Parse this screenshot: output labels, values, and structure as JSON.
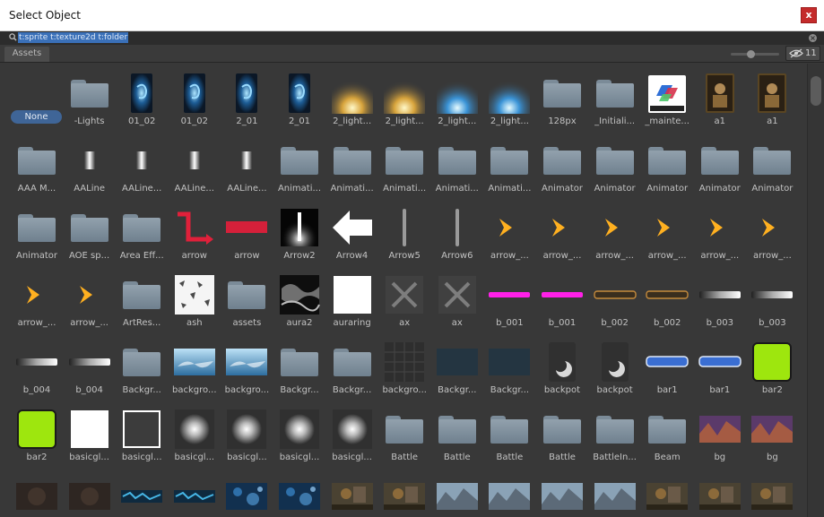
{
  "window": {
    "title": "Select Object",
    "close_label": "x"
  },
  "search": {
    "query": "t:sprite t:texture2d t:folder",
    "clear_label": "×"
  },
  "toolbar": {
    "tab_label": "Assets",
    "visible_count": "11"
  },
  "none_label": "None",
  "assets": [
    [
      "-Lights",
      "01_02",
      "01_02",
      "2_01",
      "2_01",
      "2_light...",
      "2_light...",
      "2_light...",
      "2_light...",
      "128px",
      "_Initiali...",
      "_mainte...",
      "a1",
      "a1"
    ],
    [
      "AAA M...",
      "AALine",
      "AALine...",
      "AALine...",
      "AALine...",
      "Animati...",
      "Animati...",
      "Animati...",
      "Animati...",
      "Animati...",
      "Animator",
      "Animator",
      "Animator",
      "Animator",
      "Animator"
    ],
    [
      "Animator",
      "AOE sp...",
      "Area Eff...",
      "arrow",
      "arrow",
      "Arrow2",
      "Arrow4",
      "Arrow5",
      "Arrow6",
      "arrow_...",
      "arrow_...",
      "arrow_...",
      "arrow_...",
      "arrow_...",
      "arrow_..."
    ],
    [
      "arrow_...",
      "arrow_...",
      "ArtRes...",
      "ash",
      "assets",
      "aura2",
      "auraring",
      "ax",
      "ax",
      "b_001",
      "b_001",
      "b_002",
      "b_002",
      "b_003",
      "b_003"
    ],
    [
      "b_004",
      "b_004",
      "Backgr...",
      "backgro...",
      "backgro...",
      "Backgr...",
      "Backgr...",
      "backgro...",
      "Backgr...",
      "Backgr...",
      "backpot",
      "backpot",
      "bar1",
      "bar1",
      "bar2"
    ],
    [
      "bar2",
      "basicgl...",
      "basicgl...",
      "basicgl...",
      "basicgl...",
      "basicgl...",
      "basicgl...",
      "Battle",
      "Battle",
      "Battle",
      "Battle",
      "BattleIn...",
      "Beam",
      "bg",
      "bg"
    ],
    [
      "",
      "",
      "",
      "",
      "",
      "",
      "",
      "",
      "",
      "",
      "",
      "",
      "",
      "",
      ""
    ]
  ],
  "icons": [
    [
      "folder-icon",
      "blue-swirl-card-icon",
      "blue-swirl-card-icon",
      "blue-swirl-card-icon",
      "blue-swirl-card-icon",
      "gold-light-beam-icon",
      "gold-light-beam-icon",
      "blue-light-beam-icon",
      "blue-light-beam-icon",
      "folder-icon",
      "folder-icon",
      "shadero-logo-icon",
      "character-card-icon",
      "character-card-icon"
    ],
    [
      "folder-icon",
      "aa-line-icon",
      "aa-line-icon",
      "aa-line-icon",
      "aa-line-icon",
      "folder-icon",
      "folder-icon",
      "folder-icon",
      "folder-icon",
      "folder-icon",
      "folder-icon",
      "folder-icon",
      "folder-icon",
      "folder-icon",
      "folder-icon"
    ],
    [
      "folder-icon",
      "folder-icon",
      "folder-icon",
      "red-path-arrow-icon",
      "red-bar-icon",
      "light-pillar-icon",
      "white-arrow-icon",
      "thin-line-icon",
      "thin-line-icon",
      "orange-chevron-icon",
      "orange-chevron-icon",
      "orange-chevron-icon",
      "orange-chevron-icon",
      "orange-chevron-icon",
      "orange-chevron-icon"
    ],
    [
      "orange-chevron-icon",
      "orange-chevron-icon",
      "folder-icon",
      "ash-texture-icon",
      "folder-icon",
      "smoke-texture-icon",
      "white-square-icon",
      "axe-cross-icon",
      "axe-cross-icon",
      "magenta-bar-icon",
      "magenta-bar-icon",
      "gold-frame-bar-icon",
      "gold-frame-bar-icon",
      "gray-gradient-bar-icon",
      "gray-gradient-bar-icon"
    ],
    [
      "gray-gradient-bar-icon",
      "gray-gradient-bar-icon",
      "folder-icon",
      "sky-texture-icon",
      "sky-texture-icon",
      "folder-icon",
      "folder-icon",
      "dark-grid-icon",
      "dark-blue-texture-icon",
      "dark-blue-texture-icon",
      "crescent-moon-icon",
      "crescent-moon-icon",
      "blue-bar-icon",
      "blue-bar-icon",
      "lime-button-icon"
    ],
    [
      "lime-button-icon",
      "white-square-icon",
      "outlined-square-icon",
      "glow-icon",
      "glow-icon",
      "glow-icon",
      "glow-icon",
      "folder-icon",
      "folder-icon",
      "folder-icon",
      "folder-icon",
      "folder-icon",
      "folder-icon",
      "purple-texture-icon",
      "purple-texture-icon"
    ],
    [
      "dark-texture-icon",
      "dark-texture-icon",
      "blue-strip-icon",
      "blue-strip-icon",
      "blue-noise-icon",
      "blue-noise-icon",
      "battle-scene-icon",
      "battle-scene-icon",
      "rocky-scene-icon",
      "rocky-scene-icon",
      "rocky-scene-icon",
      "rocky-scene-icon",
      "battle-scene-icon",
      "battle-scene-icon",
      "battle-scene-icon"
    ]
  ]
}
